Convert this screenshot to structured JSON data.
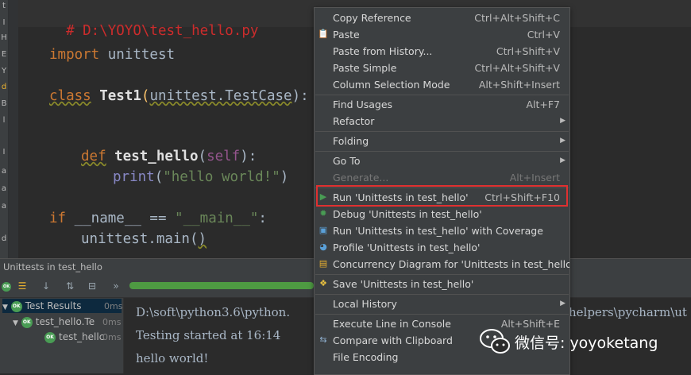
{
  "editor": {
    "lines": {
      "comment": "# D:\\YOYO\\test_hello.py",
      "import_kw": "import",
      "import_mod": " unittest",
      "class_kw": "class",
      "class_name": " Test1",
      "class_paren_open": "(",
      "class_base": "unittest.TestCase",
      "class_paren_close": "):",
      "def_kw": "def",
      "def_name": " test_hello",
      "def_paren_open": "(",
      "def_self": "self",
      "def_paren_close": "):",
      "print_fn": "print",
      "print_open": "(",
      "print_str": "\"hello world!\"",
      "print_close": ")",
      "if_kw": "if",
      "if_name": " __name__ == ",
      "if_str": "\"__main__\"",
      "if_colon": ":",
      "main_call": "unittest.main",
      "main_open": "(",
      "main_close": ")"
    },
    "strip_letters": [
      "t",
      "I",
      "H",
      "E",
      "Y",
      "d",
      "B",
      "l",
      "I",
      "a",
      "a",
      "a",
      "d"
    ]
  },
  "run_panel": {
    "title": "Unittests in test_hello",
    "progress_percent": 100,
    "tree": [
      {
        "label": "Test Results",
        "time": "0ms",
        "indent": 0
      },
      {
        "label": "test_hello.Te",
        "time": "0ms",
        "indent": 1
      },
      {
        "label": "test_hellc",
        "time": "0ms",
        "indent": 2
      }
    ],
    "ok_badge": "OK",
    "console": {
      "line1": "D:\\soft\\python3.6\\python.",
      "line1_right": "helpers\\pycharm\\ut",
      "line2": "Testing started at 16:14",
      "line3": "hello world!"
    }
  },
  "context_menu": {
    "items": [
      {
        "label": "Copy Reference",
        "shortcut": "Ctrl+Alt+Shift+C"
      },
      {
        "label": "Paste",
        "shortcut": "Ctrl+V",
        "icon": "paste-icon"
      },
      {
        "label": "Paste from History...",
        "shortcut": "Ctrl+Shift+V"
      },
      {
        "label": "Paste Simple",
        "shortcut": "Ctrl+Alt+Shift+V"
      },
      {
        "label": "Column Selection Mode",
        "shortcut": "Alt+Shift+Insert"
      },
      {
        "label": "Find Usages",
        "shortcut": "Alt+F7"
      },
      {
        "label": "Refactor",
        "shortcut": ""
      },
      {
        "label": "Folding",
        "shortcut": ""
      },
      {
        "label": "Go To",
        "shortcut": ""
      },
      {
        "label": "Generate...",
        "shortcut": "Alt+Insert"
      },
      {
        "label": "Run 'Unittests in test_hello'",
        "shortcut": "Ctrl+Shift+F10",
        "icon": "run-icon"
      },
      {
        "label": "Debug 'Unittests in test_hello'",
        "shortcut": "",
        "icon": "debug-icon"
      },
      {
        "label": "Run 'Unittests in test_hello' with Coverage",
        "shortcut": "",
        "icon": "coverage-icon"
      },
      {
        "label": "Profile 'Unittests in test_hello'",
        "shortcut": "",
        "icon": "profile-icon"
      },
      {
        "label": "Concurrency Diagram for  'Unittests in test_hello'",
        "shortcut": "",
        "icon": "concurrency-icon"
      },
      {
        "label": "Save 'Unittests in test_hello'",
        "shortcut": "",
        "icon": "python-icon"
      },
      {
        "label": "Local History",
        "shortcut": ""
      },
      {
        "label": "Execute Line in Console",
        "shortcut": "Alt+Shift+E"
      },
      {
        "label": "Compare with Clipboard",
        "shortcut": "",
        "icon": "compare-icon"
      },
      {
        "label": "File Encoding",
        "shortcut": ""
      }
    ]
  },
  "watermark": {
    "text": "微信号: yoyoketang"
  },
  "colors": {
    "highlight_border": "#e03030",
    "ok_green": "#499c54",
    "run_green": "#4e9a42"
  }
}
